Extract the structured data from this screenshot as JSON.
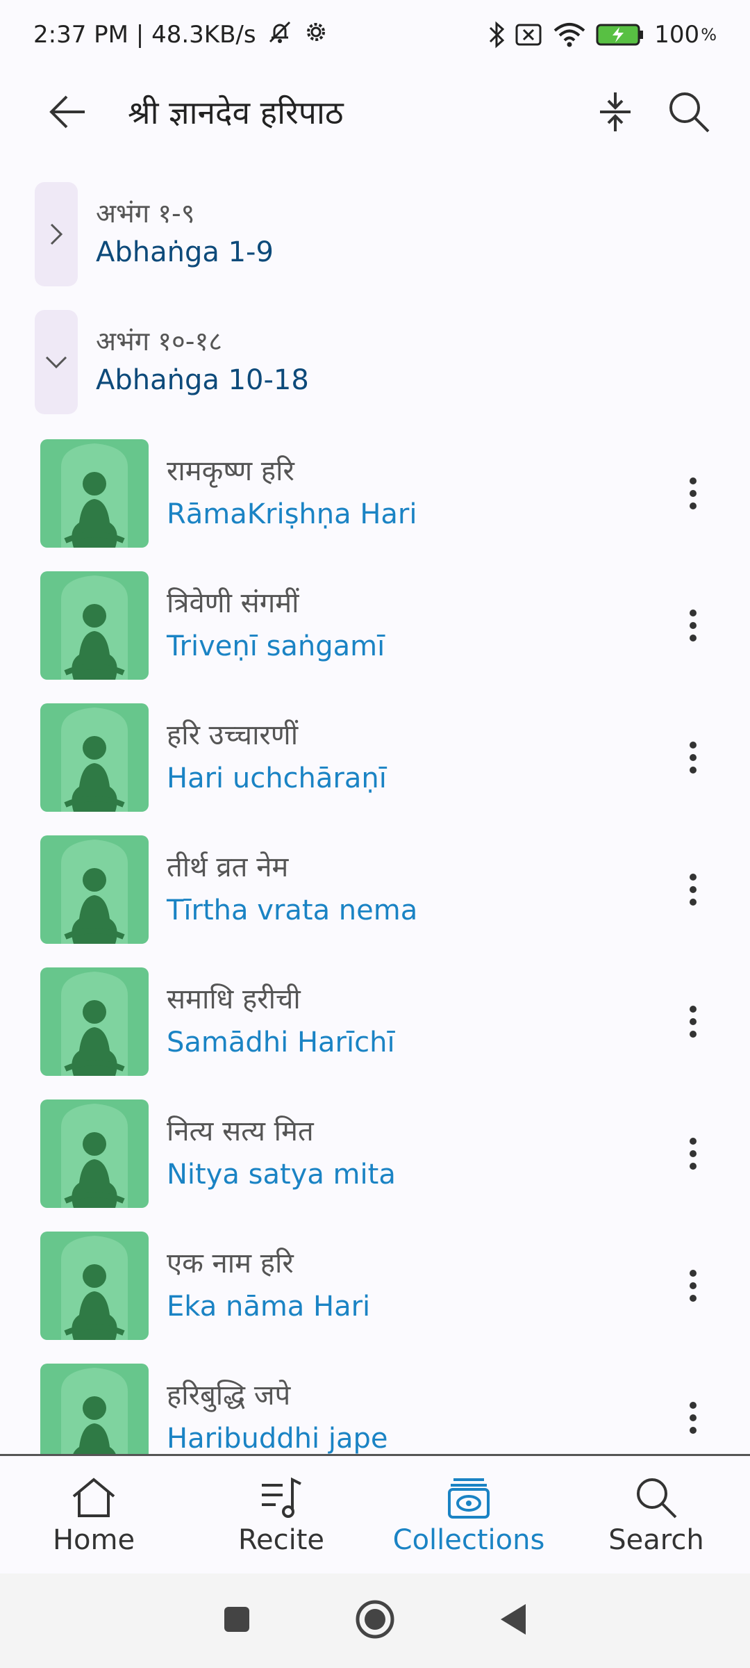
{
  "status": {
    "time_net": "2:37 PM | 48.3KB/s",
    "battery": "100"
  },
  "appbar": {
    "title": "श्री ज्ञानदेव हरिपाठ"
  },
  "sections": [
    {
      "dev": "अभंग १-९",
      "en": "Abhaṅga 1-9",
      "state": "collapsed"
    },
    {
      "dev": "अभंग १०-१८",
      "en": "Abhaṅga 10-18",
      "state": "expanded"
    }
  ],
  "items": [
    {
      "dev": "रामकृष्ण हरि",
      "en": "RāmaKriṣhṇa Hari"
    },
    {
      "dev": "त्रिवेणी संगमीं",
      "en": "Triveṇī saṅgamī"
    },
    {
      "dev": "हरि उच्चारणीं",
      "en": "Hari uchchāraṇī"
    },
    {
      "dev": "तीर्थ व्रत नेम",
      "en": "Tīrtha vrata nema"
    },
    {
      "dev": "समाधि हरीची",
      "en": "Samādhi Harīchī"
    },
    {
      "dev": "नित्य सत्य मित",
      "en": "Nitya satya mita"
    },
    {
      "dev": "एक नाम हरि",
      "en": "Eka nāma Hari"
    },
    {
      "dev": "हरिबुद्धि जपे",
      "en": "Haribuddhi jape"
    }
  ],
  "nav": [
    {
      "label": "Home",
      "icon": "home-icon"
    },
    {
      "label": "Recite",
      "icon": "music-list-icon"
    },
    {
      "label": "Collections",
      "icon": "collections-icon",
      "active": true
    },
    {
      "label": "Search",
      "icon": "search-icon"
    }
  ],
  "colors": {
    "accent": "#1a83c4",
    "section_text": "#0d4a7a",
    "thumb_bg": "#67c68c",
    "thumb_figure": "#2f7a45",
    "chevron_bg": "#efe9f6"
  }
}
